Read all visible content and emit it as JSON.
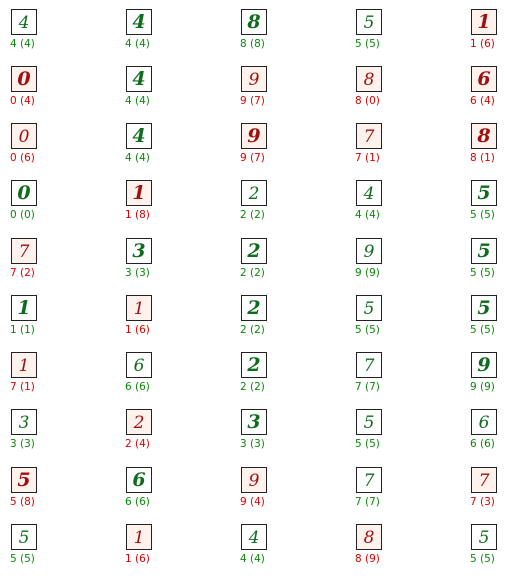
{
  "colors": {
    "correct": "#0a8a0a",
    "wrong": "#e00000",
    "ink_correct": "#0f6b1e",
    "ink_wrong": "#a01010"
  },
  "grid": [
    [
      {
        "digit": "4",
        "label": "4 (4)",
        "correct": true,
        "weight": "normal"
      },
      {
        "digit": "4",
        "label": "4 (4)",
        "correct": true,
        "weight": "bold"
      },
      {
        "digit": "8",
        "label": "8 (8)",
        "correct": true,
        "weight": "bold"
      },
      {
        "digit": "5",
        "label": "5 (5)",
        "correct": true,
        "weight": "normal"
      },
      {
        "digit": "1",
        "label": "1 (6)",
        "correct": false,
        "weight": "bold"
      }
    ],
    [
      {
        "digit": "0",
        "label": "0 (4)",
        "correct": false,
        "weight": "bold"
      },
      {
        "digit": "4",
        "label": "4 (4)",
        "correct": true,
        "weight": "bold"
      },
      {
        "digit": "9",
        "label": "9 (7)",
        "correct": false,
        "weight": "normal"
      },
      {
        "digit": "8",
        "label": "8 (0)",
        "correct": false,
        "weight": "normal"
      },
      {
        "digit": "6",
        "label": "6 (4)",
        "correct": false,
        "weight": "bold"
      }
    ],
    [
      {
        "digit": "0",
        "label": "0 (6)",
        "correct": false,
        "weight": "normal"
      },
      {
        "digit": "4",
        "label": "4 (4)",
        "correct": true,
        "weight": "bold"
      },
      {
        "digit": "9",
        "label": "9 (7)",
        "correct": false,
        "weight": "bold"
      },
      {
        "digit": "7",
        "label": "7 (1)",
        "correct": false,
        "weight": "normal"
      },
      {
        "digit": "8",
        "label": "8 (1)",
        "correct": false,
        "weight": "bold"
      }
    ],
    [
      {
        "digit": "0",
        "label": "0 (0)",
        "correct": true,
        "weight": "bold"
      },
      {
        "digit": "1",
        "label": "1 (8)",
        "correct": false,
        "weight": "bold"
      },
      {
        "digit": "2",
        "label": "2 (2)",
        "correct": true,
        "weight": "normal"
      },
      {
        "digit": "4",
        "label": "4 (4)",
        "correct": true,
        "weight": "normal"
      },
      {
        "digit": "5",
        "label": "5 (5)",
        "correct": true,
        "weight": "bold"
      }
    ],
    [
      {
        "digit": "7",
        "label": "7 (2)",
        "correct": false,
        "weight": "normal"
      },
      {
        "digit": "3",
        "label": "3 (3)",
        "correct": true,
        "weight": "bold"
      },
      {
        "digit": "2",
        "label": "2 (2)",
        "correct": true,
        "weight": "bold"
      },
      {
        "digit": "9",
        "label": "9 (9)",
        "correct": true,
        "weight": "normal"
      },
      {
        "digit": "5",
        "label": "5 (5)",
        "correct": true,
        "weight": "bold"
      }
    ],
    [
      {
        "digit": "1",
        "label": "1 (1)",
        "correct": true,
        "weight": "bold"
      },
      {
        "digit": "1",
        "label": "1 (6)",
        "correct": false,
        "weight": "normal"
      },
      {
        "digit": "2",
        "label": "2 (2)",
        "correct": true,
        "weight": "bold"
      },
      {
        "digit": "5",
        "label": "5 (5)",
        "correct": true,
        "weight": "normal"
      },
      {
        "digit": "5",
        "label": "5 (5)",
        "correct": true,
        "weight": "bold"
      }
    ],
    [
      {
        "digit": "1",
        "label": "7 (1)",
        "correct": false,
        "weight": "normal"
      },
      {
        "digit": "6",
        "label": "6 (6)",
        "correct": true,
        "weight": "normal"
      },
      {
        "digit": "2",
        "label": "2 (2)",
        "correct": true,
        "weight": "bold"
      },
      {
        "digit": "7",
        "label": "7 (7)",
        "correct": true,
        "weight": "normal"
      },
      {
        "digit": "9",
        "label": "9 (9)",
        "correct": true,
        "weight": "bold"
      }
    ],
    [
      {
        "digit": "3",
        "label": "3 (3)",
        "correct": true,
        "weight": "normal"
      },
      {
        "digit": "2",
        "label": "2 (4)",
        "correct": false,
        "weight": "normal"
      },
      {
        "digit": "3",
        "label": "3 (3)",
        "correct": true,
        "weight": "bold"
      },
      {
        "digit": "5",
        "label": "5 (5)",
        "correct": true,
        "weight": "normal"
      },
      {
        "digit": "6",
        "label": "6 (6)",
        "correct": true,
        "weight": "normal"
      }
    ],
    [
      {
        "digit": "5",
        "label": "5 (8)",
        "correct": false,
        "weight": "bold"
      },
      {
        "digit": "6",
        "label": "6 (6)",
        "correct": true,
        "weight": "bold"
      },
      {
        "digit": "9",
        "label": "9 (4)",
        "correct": false,
        "weight": "normal"
      },
      {
        "digit": "7",
        "label": "7 (7)",
        "correct": true,
        "weight": "normal"
      },
      {
        "digit": "7",
        "label": "7 (3)",
        "correct": false,
        "weight": "normal"
      }
    ],
    [
      {
        "digit": "5",
        "label": "5 (5)",
        "correct": true,
        "weight": "normal"
      },
      {
        "digit": "1",
        "label": "1 (6)",
        "correct": false,
        "weight": "normal"
      },
      {
        "digit": "4",
        "label": "4 (4)",
        "correct": true,
        "weight": "normal"
      },
      {
        "digit": "8",
        "label": "8 (9)",
        "correct": false,
        "weight": "normal"
      },
      {
        "digit": "5",
        "label": "5 (5)",
        "correct": true,
        "weight": "normal"
      }
    ]
  ]
}
